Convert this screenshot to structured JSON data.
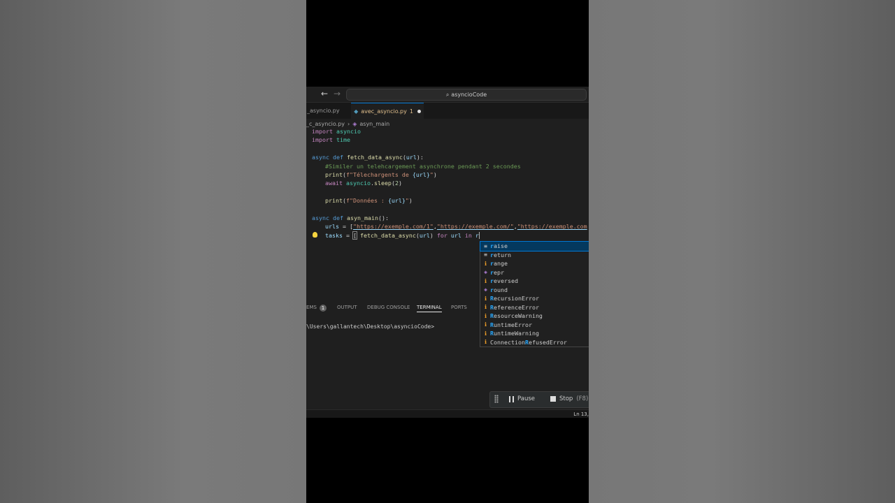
{
  "search": {
    "text": "asyncioCode"
  },
  "tabs": [
    {
      "label": "_asyncio.py",
      "active": false
    },
    {
      "label": "avec_asyncio.py",
      "problems": "1",
      "active": true,
      "modified": true
    }
  ],
  "breadcrumb": {
    "file": "_c_asyncio.py",
    "symbol": "asyn_main"
  },
  "code": {
    "l1": {
      "kw": "import",
      "mod": "asyncio"
    },
    "l2": {
      "kw": "import",
      "mod": "time"
    },
    "l4": {
      "kw1": "async",
      "kw2": "def",
      "fn": "fetch_data_async",
      "open": "(",
      "param": "url",
      "close": "):"
    },
    "l5": {
      "comment": "#Similer un telehcargement asynchrone pendant 2 secondes"
    },
    "l6": {
      "fn": "print",
      "open": "(",
      "str1": "f\"Télechargents de ",
      "var": "{url}",
      "str2": "\"",
      "close": ")"
    },
    "l7": {
      "kw": "await",
      "mod": "asyncio",
      "dot": ".",
      "fn": "sleep",
      "open": "(",
      "num": "2",
      "close": ")"
    },
    "l9": {
      "fn": "print",
      "open": "(",
      "str1": "f\"Données : ",
      "var": "{url}",
      "str2": "\"",
      "close": ")"
    },
    "l11": {
      "kw1": "async",
      "kw2": "def",
      "fn": "asyn_main",
      "rest": "():"
    },
    "l12": {
      "var": "urls",
      "eq": " = [",
      "s1": "\"https://exemple.com/1\"",
      "c1": ",",
      "s2": "\"https://exemple.com/\"",
      "c2": ",",
      "s3": "\"https://exemple.com"
    },
    "l13": {
      "var": "tasks",
      "eq": " = ",
      "br": "[",
      "sp": " ",
      "fn": "fetch_data_async",
      "open": "(",
      "arg": "url",
      "close": ")",
      "kw_for": "for",
      "v": "url",
      "kw_in": "in",
      "typed": "r"
    }
  },
  "suggestions": [
    {
      "icon": "keyword-icon",
      "glyph": "≡",
      "match": "r",
      "rest": "aise",
      "kind": "kw"
    },
    {
      "icon": "keyword-icon",
      "glyph": "≡",
      "match": "r",
      "rest": "eturn",
      "kind": "kw"
    },
    {
      "icon": "class-icon",
      "glyph": "ℹ",
      "match": "r",
      "rest": "ange",
      "kind": "cls"
    },
    {
      "icon": "function-icon",
      "glyph": "◈",
      "match": "r",
      "rest": "epr",
      "kind": "fn"
    },
    {
      "icon": "class-icon",
      "glyph": "ℹ",
      "match": "r",
      "rest": "eversed",
      "kind": "cls"
    },
    {
      "icon": "function-icon",
      "glyph": "◈",
      "match": "r",
      "rest": "ound",
      "kind": "fn"
    },
    {
      "icon": "class-icon",
      "glyph": "ℹ",
      "match": "R",
      "rest": "ecursionError",
      "kind": "cls"
    },
    {
      "icon": "class-icon",
      "glyph": "ℹ",
      "match": "R",
      "rest": "eferenceError",
      "kind": "cls"
    },
    {
      "icon": "class-icon",
      "glyph": "ℹ",
      "match": "R",
      "rest": "esourceWarning",
      "kind": "cls"
    },
    {
      "icon": "class-icon",
      "glyph": "ℹ",
      "match": "R",
      "rest": "untimeError",
      "kind": "cls"
    },
    {
      "icon": "class-icon",
      "glyph": "ℹ",
      "match": "R",
      "rest": "untimeWarning",
      "kind": "cls"
    },
    {
      "icon": "class-icon",
      "glyph": "ℹ",
      "pre": "Connection",
      "match": "R",
      "rest": "efusedError",
      "kind": "cls"
    }
  ],
  "panel": {
    "problems_label": "EMS",
    "problems_count": "1",
    "output": "OUTPUT",
    "debug_console": "DEBUG CONSOLE",
    "terminal": "TERMINAL",
    "ports": "PORTS",
    "terminal_line": "\\Users\\gallantech\\Desktop\\asyncioCode>"
  },
  "debug": {
    "pause": "Pause",
    "stop": "Stop",
    "stop_key": "(F8)"
  },
  "status": {
    "position": "Ln 13,"
  }
}
